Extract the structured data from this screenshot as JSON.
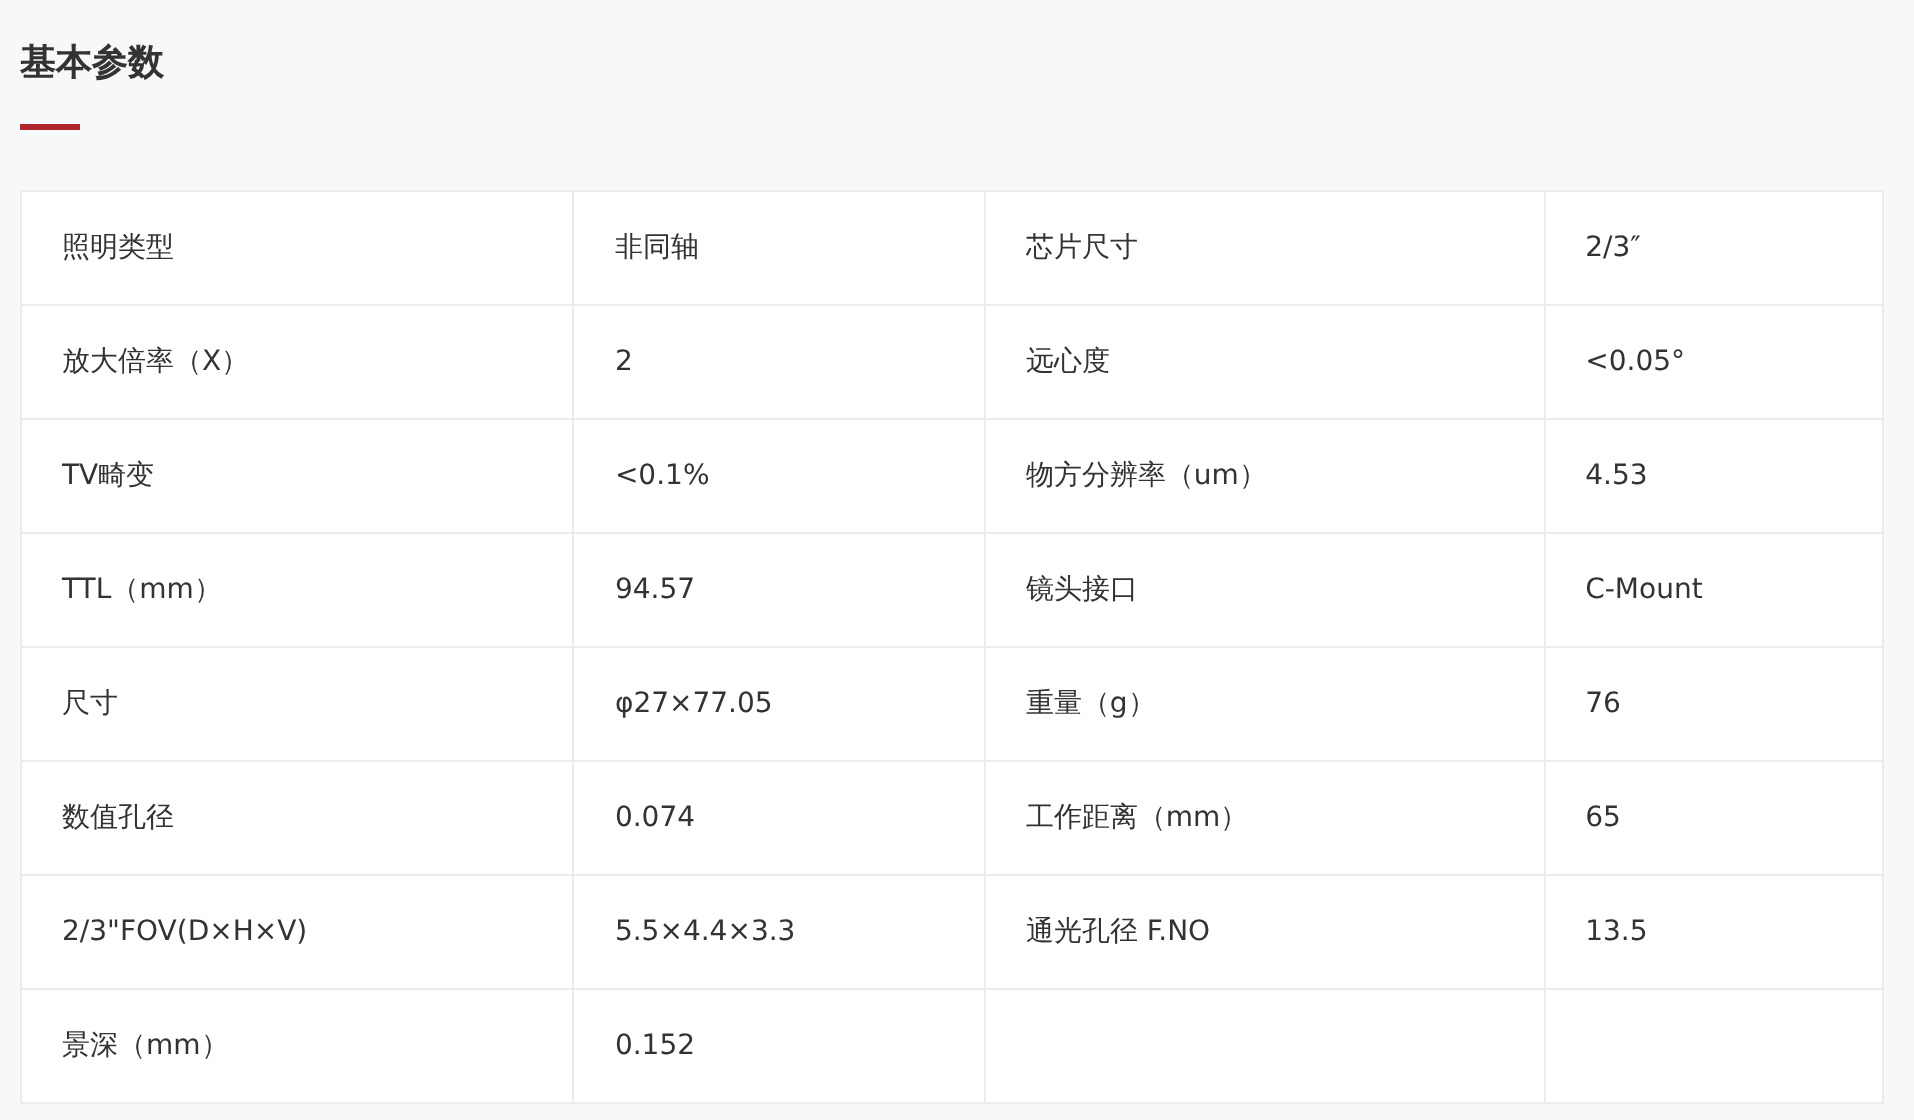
{
  "section": {
    "title": "基本参数"
  },
  "table": {
    "rows": [
      {
        "cells": [
          "照明类型",
          "非同轴",
          "芯片尺寸",
          "2/3″"
        ]
      },
      {
        "cells": [
          "放大倍率（X）",
          "2",
          "远心度",
          "<0.05°"
        ]
      },
      {
        "cells": [
          "TV畸变",
          "<0.1%",
          "物方分辨率（um）",
          "4.53"
        ]
      },
      {
        "cells": [
          "TTL（mm）",
          "94.57",
          "镜头接口",
          "C-Mount"
        ]
      },
      {
        "cells": [
          "尺寸",
          "φ27×77.05",
          "重量（g）",
          "76"
        ]
      },
      {
        "cells": [
          "数值孔径",
          "0.074",
          "工作距离（mm）",
          "65"
        ]
      },
      {
        "cells": [
          "2/3\"FOV(D×H×V)",
          "5.5×4.4×3.3",
          "通光孔径 F.NO",
          "13.5"
        ]
      },
      {
        "cells": [
          "景深（mm）",
          "0.152"
        ]
      }
    ]
  }
}
